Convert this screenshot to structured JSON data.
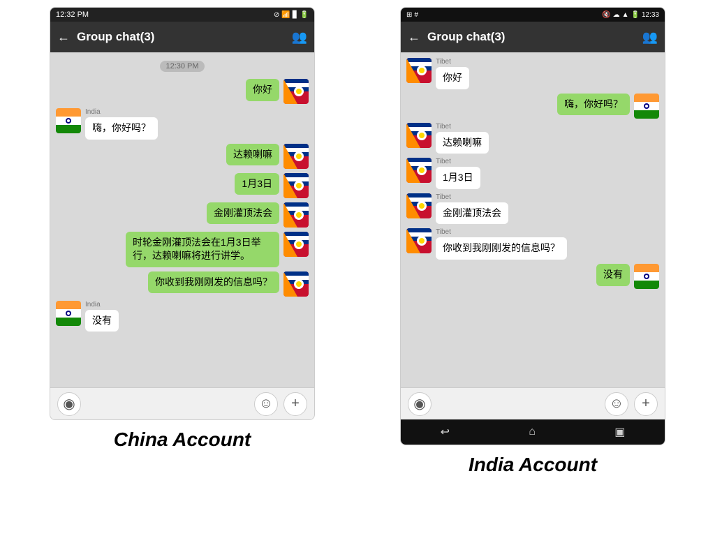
{
  "china": {
    "label": "China Account",
    "status_bar": {
      "time": "12:32 PM",
      "icons": "✕ ☁ ▲ 🔋"
    },
    "header": {
      "title": "Group chat(3)"
    },
    "timestamp": "12:30 PM",
    "messages": [
      {
        "id": 1,
        "side": "right",
        "avatar": "tibet",
        "text": "你好",
        "sender": ""
      },
      {
        "id": 2,
        "side": "left",
        "avatar": "india",
        "text": "嗨，你好吗？",
        "sender": "India"
      },
      {
        "id": 3,
        "side": "right",
        "avatar": "tibet",
        "text": "达赖喇嘛",
        "sender": ""
      },
      {
        "id": 4,
        "side": "right",
        "avatar": "tibet",
        "text": "1月3日",
        "sender": ""
      },
      {
        "id": 5,
        "side": "right",
        "avatar": "tibet",
        "text": "金刚灌顶法会",
        "sender": ""
      },
      {
        "id": 6,
        "side": "right",
        "avatar": "tibet",
        "text": "时轮金刚灌顶法会在1月3日举行，达赖喇嘛将进行讲学。",
        "sender": ""
      },
      {
        "id": 7,
        "side": "right",
        "avatar": "tibet",
        "text": "你收到我刚刚发的信息吗？",
        "sender": ""
      },
      {
        "id": 8,
        "side": "left",
        "avatar": "india",
        "text": "没有",
        "sender": "India"
      }
    ]
  },
  "india": {
    "label": "India Account",
    "status_bar": {
      "time": "12:33",
      "icons": "🔇 ☁ ▲ 🔋"
    },
    "header": {
      "title": "Group chat(3)"
    },
    "messages": [
      {
        "id": 1,
        "side": "left",
        "avatar": "tibet",
        "text": "你好",
        "sender": "Tibet"
      },
      {
        "id": 2,
        "side": "right",
        "avatar": "india",
        "text": "嗨，你好吗？",
        "sender": ""
      },
      {
        "id": 3,
        "side": "left",
        "avatar": "tibet",
        "text": "达赖喇嘛",
        "sender": "Tibet"
      },
      {
        "id": 4,
        "side": "left",
        "avatar": "tibet",
        "text": "1月3日",
        "sender": "Tibet"
      },
      {
        "id": 5,
        "side": "left",
        "avatar": "tibet",
        "text": "金刚灌顶法会",
        "sender": "Tibet"
      },
      {
        "id": 6,
        "side": "left",
        "avatar": "tibet",
        "text": "你收到我刚刚发的信息吗？",
        "sender": "Tibet"
      },
      {
        "id": 7,
        "side": "right",
        "avatar": "india",
        "text": "没有",
        "sender": ""
      }
    ]
  },
  "icons": {
    "back": "←",
    "contacts": "👤",
    "voice": "◉",
    "emoji": "☺",
    "plus": "+",
    "nav_back": "↩",
    "nav_home": "⌂",
    "nav_recent": "▣"
  }
}
